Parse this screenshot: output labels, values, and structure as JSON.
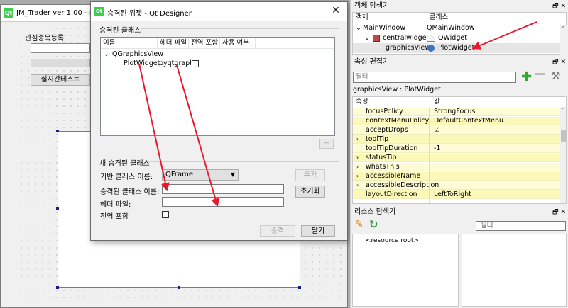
{
  "background_window": {
    "title": "JM_Trader ver 1.00 - mai",
    "groupbox_label": "관심종목등록",
    "button_label": "실시간테스트"
  },
  "dialog": {
    "title": "승격된 위젯 - Qt Designer",
    "close_glyph": "✕",
    "promoted_group_title": "승격된 클래스",
    "list_headers": [
      "이름",
      "헤더 파일",
      "전역 포함",
      "사용 여부"
    ],
    "tree_parent": "QGraphicsView",
    "tree_child_name": "PlotWidget",
    "tree_child_header": "pyqtgraph",
    "remove_button": "—",
    "new_group_title": "새 승격된 클래스",
    "base_class_label": "기반 클래스 이름:",
    "base_class_value": "QFrame",
    "promoted_name_label": "승격된 클래스 이름:",
    "promoted_name_value": "",
    "header_file_label": "헤더 파일:",
    "header_file_value": "",
    "global_include_label": "전역 포함",
    "add_button": "추가",
    "reset_button": "초기화",
    "promote_button": "승격",
    "close_button": "닫기"
  },
  "object_inspector": {
    "title": "객체 탐색기",
    "dock_buttons": "🗗 ✕",
    "headers": [
      "객체",
      "클래스"
    ],
    "rows": [
      {
        "object": "MainWindow",
        "class": "QMainWindow"
      },
      {
        "object": "centralwidget",
        "class": "QWidget"
      },
      {
        "object": "graphicsView",
        "class": "PlotWidget"
      }
    ]
  },
  "property_editor": {
    "title": "속성 편집기",
    "dock_buttons": "🗗 ✕",
    "filter_placeholder": "필터",
    "class_label": "graphicsView : PlotWidget",
    "headers": [
      "속성",
      "값"
    ],
    "rows": [
      {
        "name": "focusPolicy",
        "value": "StrongFocus",
        "expand": ""
      },
      {
        "name": "contextMenuPolicy",
        "value": "DefaultContextMenu",
        "expand": ""
      },
      {
        "name": "acceptDrops",
        "value": "☑",
        "expand": ""
      },
      {
        "name": "toolTip",
        "value": "",
        "expand": "›"
      },
      {
        "name": "toolTipDuration",
        "value": "-1",
        "expand": ""
      },
      {
        "name": "statusTip",
        "value": "",
        "expand": "›"
      },
      {
        "name": "whatsThis",
        "value": "",
        "expand": "›"
      },
      {
        "name": "accessibleName",
        "value": "",
        "expand": "›"
      },
      {
        "name": "accessibleDescription",
        "value": "",
        "expand": "›"
      },
      {
        "name": "layoutDirection",
        "value": "LeftToRight",
        "expand": ""
      }
    ]
  },
  "resource_browser": {
    "title": "리소스 탐색기",
    "dock_buttons": "🗗 ✕",
    "filter_placeholder": "필터",
    "root_label": "<resource root>"
  },
  "colors": {
    "arrow": "#e8182e",
    "qt_green": "#41cd52",
    "property_row": "#fdfcd4"
  }
}
